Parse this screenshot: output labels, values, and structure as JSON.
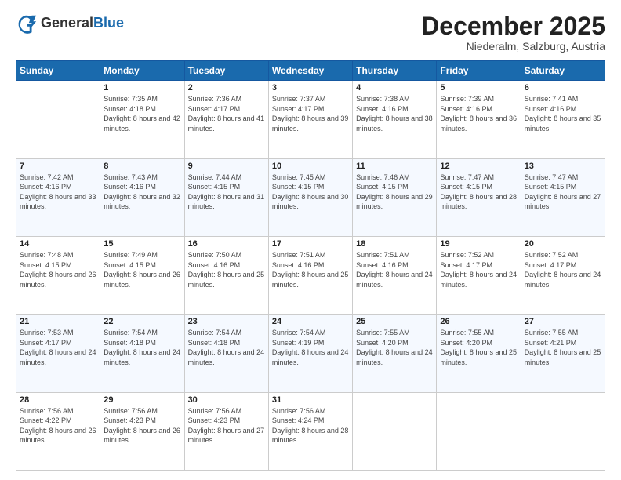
{
  "logo": {
    "general": "General",
    "blue": "Blue"
  },
  "header": {
    "month": "December 2025",
    "location": "Niederalm, Salzburg, Austria"
  },
  "days_of_week": [
    "Sunday",
    "Monday",
    "Tuesday",
    "Wednesday",
    "Thursday",
    "Friday",
    "Saturday"
  ],
  "weeks": [
    [
      {
        "day": "",
        "sunrise": "",
        "sunset": "",
        "daylight": "",
        "empty": true
      },
      {
        "day": "1",
        "sunrise": "Sunrise: 7:35 AM",
        "sunset": "Sunset: 4:18 PM",
        "daylight": "Daylight: 8 hours and 42 minutes."
      },
      {
        "day": "2",
        "sunrise": "Sunrise: 7:36 AM",
        "sunset": "Sunset: 4:17 PM",
        "daylight": "Daylight: 8 hours and 41 minutes."
      },
      {
        "day": "3",
        "sunrise": "Sunrise: 7:37 AM",
        "sunset": "Sunset: 4:17 PM",
        "daylight": "Daylight: 8 hours and 39 minutes."
      },
      {
        "day": "4",
        "sunrise": "Sunrise: 7:38 AM",
        "sunset": "Sunset: 4:16 PM",
        "daylight": "Daylight: 8 hours and 38 minutes."
      },
      {
        "day": "5",
        "sunrise": "Sunrise: 7:39 AM",
        "sunset": "Sunset: 4:16 PM",
        "daylight": "Daylight: 8 hours and 36 minutes."
      },
      {
        "day": "6",
        "sunrise": "Sunrise: 7:41 AM",
        "sunset": "Sunset: 4:16 PM",
        "daylight": "Daylight: 8 hours and 35 minutes."
      }
    ],
    [
      {
        "day": "7",
        "sunrise": "Sunrise: 7:42 AM",
        "sunset": "Sunset: 4:16 PM",
        "daylight": "Daylight: 8 hours and 33 minutes."
      },
      {
        "day": "8",
        "sunrise": "Sunrise: 7:43 AM",
        "sunset": "Sunset: 4:16 PM",
        "daylight": "Daylight: 8 hours and 32 minutes."
      },
      {
        "day": "9",
        "sunrise": "Sunrise: 7:44 AM",
        "sunset": "Sunset: 4:15 PM",
        "daylight": "Daylight: 8 hours and 31 minutes."
      },
      {
        "day": "10",
        "sunrise": "Sunrise: 7:45 AM",
        "sunset": "Sunset: 4:15 PM",
        "daylight": "Daylight: 8 hours and 30 minutes."
      },
      {
        "day": "11",
        "sunrise": "Sunrise: 7:46 AM",
        "sunset": "Sunset: 4:15 PM",
        "daylight": "Daylight: 8 hours and 29 minutes."
      },
      {
        "day": "12",
        "sunrise": "Sunrise: 7:47 AM",
        "sunset": "Sunset: 4:15 PM",
        "daylight": "Daylight: 8 hours and 28 minutes."
      },
      {
        "day": "13",
        "sunrise": "Sunrise: 7:47 AM",
        "sunset": "Sunset: 4:15 PM",
        "daylight": "Daylight: 8 hours and 27 minutes."
      }
    ],
    [
      {
        "day": "14",
        "sunrise": "Sunrise: 7:48 AM",
        "sunset": "Sunset: 4:15 PM",
        "daylight": "Daylight: 8 hours and 26 minutes."
      },
      {
        "day": "15",
        "sunrise": "Sunrise: 7:49 AM",
        "sunset": "Sunset: 4:15 PM",
        "daylight": "Daylight: 8 hours and 26 minutes."
      },
      {
        "day": "16",
        "sunrise": "Sunrise: 7:50 AM",
        "sunset": "Sunset: 4:16 PM",
        "daylight": "Daylight: 8 hours and 25 minutes."
      },
      {
        "day": "17",
        "sunrise": "Sunrise: 7:51 AM",
        "sunset": "Sunset: 4:16 PM",
        "daylight": "Daylight: 8 hours and 25 minutes."
      },
      {
        "day": "18",
        "sunrise": "Sunrise: 7:51 AM",
        "sunset": "Sunset: 4:16 PM",
        "daylight": "Daylight: 8 hours and 24 minutes."
      },
      {
        "day": "19",
        "sunrise": "Sunrise: 7:52 AM",
        "sunset": "Sunset: 4:17 PM",
        "daylight": "Daylight: 8 hours and 24 minutes."
      },
      {
        "day": "20",
        "sunrise": "Sunrise: 7:52 AM",
        "sunset": "Sunset: 4:17 PM",
        "daylight": "Daylight: 8 hours and 24 minutes."
      }
    ],
    [
      {
        "day": "21",
        "sunrise": "Sunrise: 7:53 AM",
        "sunset": "Sunset: 4:17 PM",
        "daylight": "Daylight: 8 hours and 24 minutes."
      },
      {
        "day": "22",
        "sunrise": "Sunrise: 7:54 AM",
        "sunset": "Sunset: 4:18 PM",
        "daylight": "Daylight: 8 hours and 24 minutes."
      },
      {
        "day": "23",
        "sunrise": "Sunrise: 7:54 AM",
        "sunset": "Sunset: 4:18 PM",
        "daylight": "Daylight: 8 hours and 24 minutes."
      },
      {
        "day": "24",
        "sunrise": "Sunrise: 7:54 AM",
        "sunset": "Sunset: 4:19 PM",
        "daylight": "Daylight: 8 hours and 24 minutes."
      },
      {
        "day": "25",
        "sunrise": "Sunrise: 7:55 AM",
        "sunset": "Sunset: 4:20 PM",
        "daylight": "Daylight: 8 hours and 24 minutes."
      },
      {
        "day": "26",
        "sunrise": "Sunrise: 7:55 AM",
        "sunset": "Sunset: 4:20 PM",
        "daylight": "Daylight: 8 hours and 25 minutes."
      },
      {
        "day": "27",
        "sunrise": "Sunrise: 7:55 AM",
        "sunset": "Sunset: 4:21 PM",
        "daylight": "Daylight: 8 hours and 25 minutes."
      }
    ],
    [
      {
        "day": "28",
        "sunrise": "Sunrise: 7:56 AM",
        "sunset": "Sunset: 4:22 PM",
        "daylight": "Daylight: 8 hours and 26 minutes."
      },
      {
        "day": "29",
        "sunrise": "Sunrise: 7:56 AM",
        "sunset": "Sunset: 4:23 PM",
        "daylight": "Daylight: 8 hours and 26 minutes."
      },
      {
        "day": "30",
        "sunrise": "Sunrise: 7:56 AM",
        "sunset": "Sunset: 4:23 PM",
        "daylight": "Daylight: 8 hours and 27 minutes."
      },
      {
        "day": "31",
        "sunrise": "Sunrise: 7:56 AM",
        "sunset": "Sunset: 4:24 PM",
        "daylight": "Daylight: 8 hours and 28 minutes."
      },
      {
        "day": "",
        "sunrise": "",
        "sunset": "",
        "daylight": "",
        "empty": true
      },
      {
        "day": "",
        "sunrise": "",
        "sunset": "",
        "daylight": "",
        "empty": true
      },
      {
        "day": "",
        "sunrise": "",
        "sunset": "",
        "daylight": "",
        "empty": true
      }
    ]
  ]
}
